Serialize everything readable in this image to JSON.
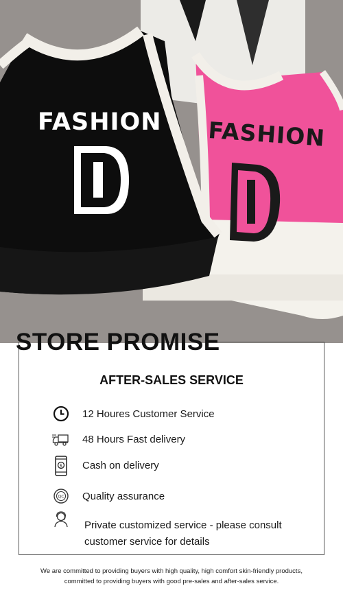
{
  "photo": {
    "black_top_print": "FASHION",
    "black_top_letter": "D",
    "pink_top_print": "FASHION",
    "pink_top_letter": "D"
  },
  "promise": {
    "title": "STORE PROMISE",
    "heading": "AFTER-SALES SERVICE",
    "items": [
      {
        "icon": "clock-icon",
        "label": "12 Houres Customer Service"
      },
      {
        "icon": "delivery-truck-icon",
        "label": "48 Hours Fast delivery"
      },
      {
        "icon": "cash-phone-icon",
        "label": "Cash on delivery"
      },
      {
        "icon": "quality-badge-icon",
        "label": "Quality assurance"
      },
      {
        "icon": "customer-service-agent-icon",
        "label": "Private customized service - please consult customer service for details"
      }
    ]
  },
  "footer": {
    "line1": "We are committed to providing buyers with high quality, high comfort skin-friendly products,",
    "line2": "committed to providing buyers with good pre-sales and after-sales service."
  },
  "colors": {
    "black_top": "#0d0d0d",
    "pink_top": "#f0529a",
    "trim": "#f2efe9",
    "background": "#9a9693"
  }
}
